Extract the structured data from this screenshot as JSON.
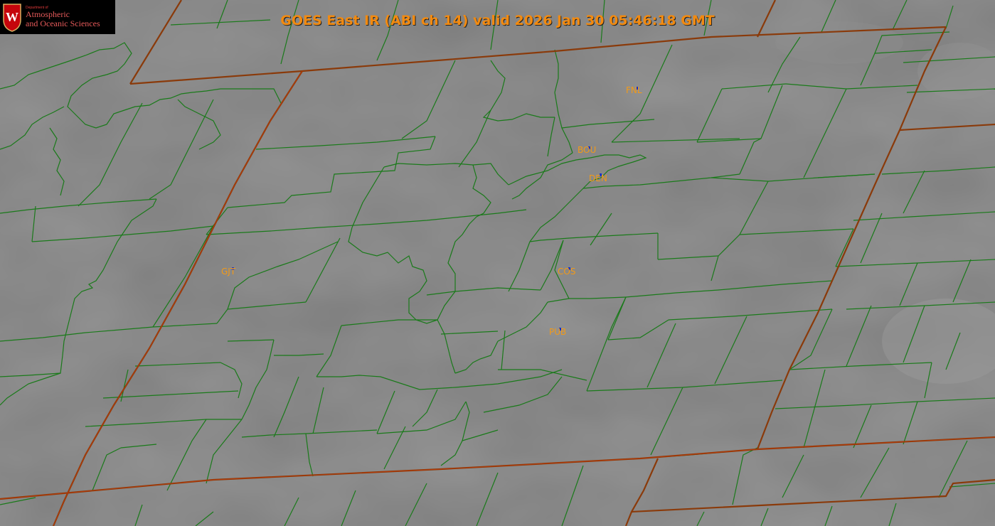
{
  "header": {
    "title": "GOES East IR (ABI ch 14) valid 2026 Jan 30 05:46:18 GMT"
  },
  "logo": {
    "dept": "Department of",
    "line1": "Atmospheric",
    "line2": "and Oceanic Sciences",
    "icon": "uw-crest-icon"
  },
  "stations": [
    {
      "id": "FNL"
    },
    {
      "id": "BOU"
    },
    {
      "id": "DEN"
    },
    {
      "id": "GJT"
    },
    {
      "id": "COS"
    },
    {
      "id": "PUB"
    }
  ],
  "colors": {
    "background": "#808080",
    "county_lines": "#1a7a1a",
    "state_lines": "#8a3a0a",
    "title_text": "#f28a10",
    "station_label": "#f29a18",
    "station_marker": "#1030d0"
  }
}
